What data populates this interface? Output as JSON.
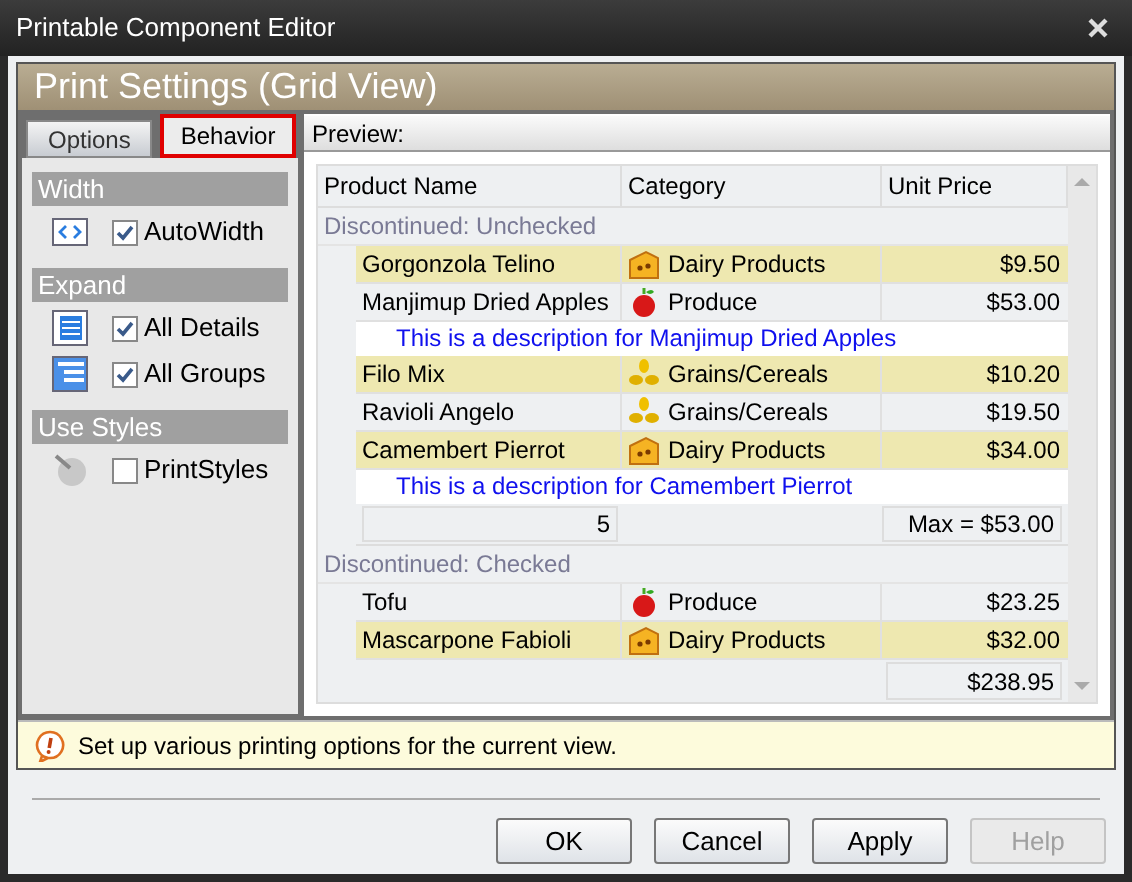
{
  "window": {
    "title": "Printable Component Editor"
  },
  "header": "Print Settings (Grid View)",
  "tabs": [
    {
      "label": "Options",
      "selected": false
    },
    {
      "label": "Behavior",
      "selected": true
    }
  ],
  "sections": [
    {
      "title": "Width",
      "items": [
        {
          "label": "AutoWidth",
          "checked": true
        }
      ]
    },
    {
      "title": "Expand",
      "items": [
        {
          "label": "All Details",
          "checked": true
        },
        {
          "label": "All Groups",
          "checked": true
        }
      ]
    },
    {
      "title": "Use Styles",
      "items": [
        {
          "label": "PrintStyles",
          "checked": false
        }
      ]
    }
  ],
  "preview": {
    "title": "Preview:",
    "columns": [
      "Product Name",
      "Category",
      "Unit Price"
    ],
    "rows": [
      {
        "kind": "group",
        "text": "Discontinued: Unchecked"
      },
      {
        "kind": "data",
        "name": "Gorgonzola Telino",
        "category": "Dairy Products",
        "price": "$9.50",
        "highlighted": true
      },
      {
        "kind": "data",
        "name": "Manjimup Dried Apples",
        "category": "Produce",
        "price": "$53.00",
        "highlighted": false
      },
      {
        "kind": "description",
        "text": "This is a description for Manjimup Dried Apples"
      },
      {
        "kind": "data",
        "name": "Filo Mix",
        "category": "Grains/Cereals",
        "price": "$10.20",
        "highlighted": true
      },
      {
        "kind": "data",
        "name": "Ravioli Angelo",
        "category": "Grains/Cereals",
        "price": "$19.50",
        "highlighted": false
      },
      {
        "kind": "data",
        "name": "Camembert Pierrot",
        "category": "Dairy Products",
        "price": "$34.00",
        "highlighted": true
      },
      {
        "kind": "description",
        "text": "This is a description for Camembert Pierrot"
      },
      {
        "kind": "summary",
        "count": "5",
        "max": "Max = $53.00"
      },
      {
        "kind": "group",
        "text": "Discontinued: Checked"
      },
      {
        "kind": "data",
        "name": "Tofu",
        "category": "Produce",
        "price": "$23.25",
        "highlighted": false
      },
      {
        "kind": "data",
        "name": "Mascarpone Fabioli",
        "category": "Dairy Products",
        "price": "$32.00",
        "highlighted": true
      },
      {
        "kind": "total",
        "sum": "$238.95"
      }
    ]
  },
  "hint": "Set up various printing options for the current view.",
  "buttons": [
    {
      "label": "OK",
      "disabled": false
    },
    {
      "label": "Cancel",
      "disabled": false
    },
    {
      "label": "Apply",
      "disabled": false
    },
    {
      "label": "Help",
      "disabled": true
    }
  ]
}
